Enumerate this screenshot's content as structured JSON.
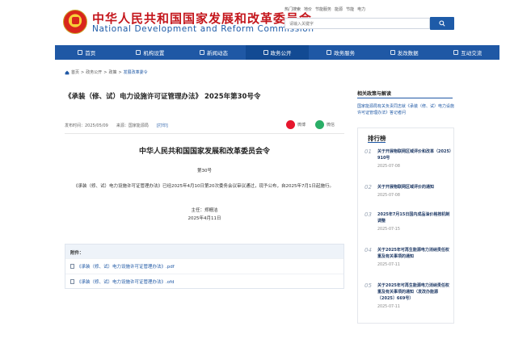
{
  "header": {
    "title_cn": "中华人民共和国国家发展和改革委员会",
    "title_en": "National Development and Reform Commission",
    "top_links": [
      "热门搜索",
      "地价",
      "节能服务",
      "能源",
      "节能",
      "电力"
    ],
    "search_placeholder": "请输入关键字"
  },
  "nav": {
    "items": [
      {
        "label": "首页",
        "icon": "home-icon"
      },
      {
        "label": "机构设置",
        "icon": "building-icon"
      },
      {
        "label": "新闻动态",
        "icon": "news-icon"
      },
      {
        "label": "政务公开",
        "icon": "gov-icon",
        "active": true
      },
      {
        "label": "政务服务",
        "icon": "service-icon"
      },
      {
        "label": "发改数据",
        "icon": "data-icon"
      },
      {
        "label": "互动交流",
        "icon": "chat-icon"
      }
    ]
  },
  "breadcrumb": {
    "items": [
      "首页",
      "政务公开",
      "政策",
      "发展改革委令"
    ]
  },
  "article": {
    "title": "《承装（修、试）电力设施许可证管理办法》 2025年第30号令",
    "date": "发布时间：2025/05/09",
    "source": "来源：国家能源局",
    "print": "[打印]",
    "share_weibo": "微博",
    "share_wechat": "微信",
    "org": "中华人民共和国国家发展和改革委员会令",
    "order_no": "第30号",
    "body": "《承装（修、试）电力设施许可证管理办法》已经2025年4月10日第20次委务会议审议通过，现予公布，自2025年7月1日起施行。",
    "sign_director": "主任：郑栅洁",
    "sign_date": "2025年4月11日"
  },
  "attachments": {
    "heading": "附件：",
    "files": [
      "《承装（修、试）电力设施许可证管理办法》.pdf",
      "《承装（修、试）电力设施许可证管理办法》.ofd"
    ]
  },
  "sidebar": {
    "related_title": "相关政策与解读",
    "related_item": "国家能源局有关负责同志就《承装（修、试）电力设施许可证管理办法》答记者问",
    "ranking_title": "排行榜",
    "ranking": [
      {
        "num": "01",
        "text": "关于开展物联网区域评价和改革（2025）910号",
        "date": "2025-07-08"
      },
      {
        "num": "02",
        "text": "关于开展物联网区域评价的通知",
        "date": "2025-07-08"
      },
      {
        "num": "03",
        "text": "2025年7月15日国内成品油价格按机制调整",
        "date": "2025-07-15"
      },
      {
        "num": "04",
        "text": "关于2025年可再生能源电力消纳责任权重及有关事项的通知",
        "date": "2025-07-11"
      },
      {
        "num": "05",
        "text": "关于2025年可再生能源电力消纳责任权重及有关事项的通知（发改办能源〔2025〕669号）",
        "date": "2025-07-11"
      }
    ]
  }
}
